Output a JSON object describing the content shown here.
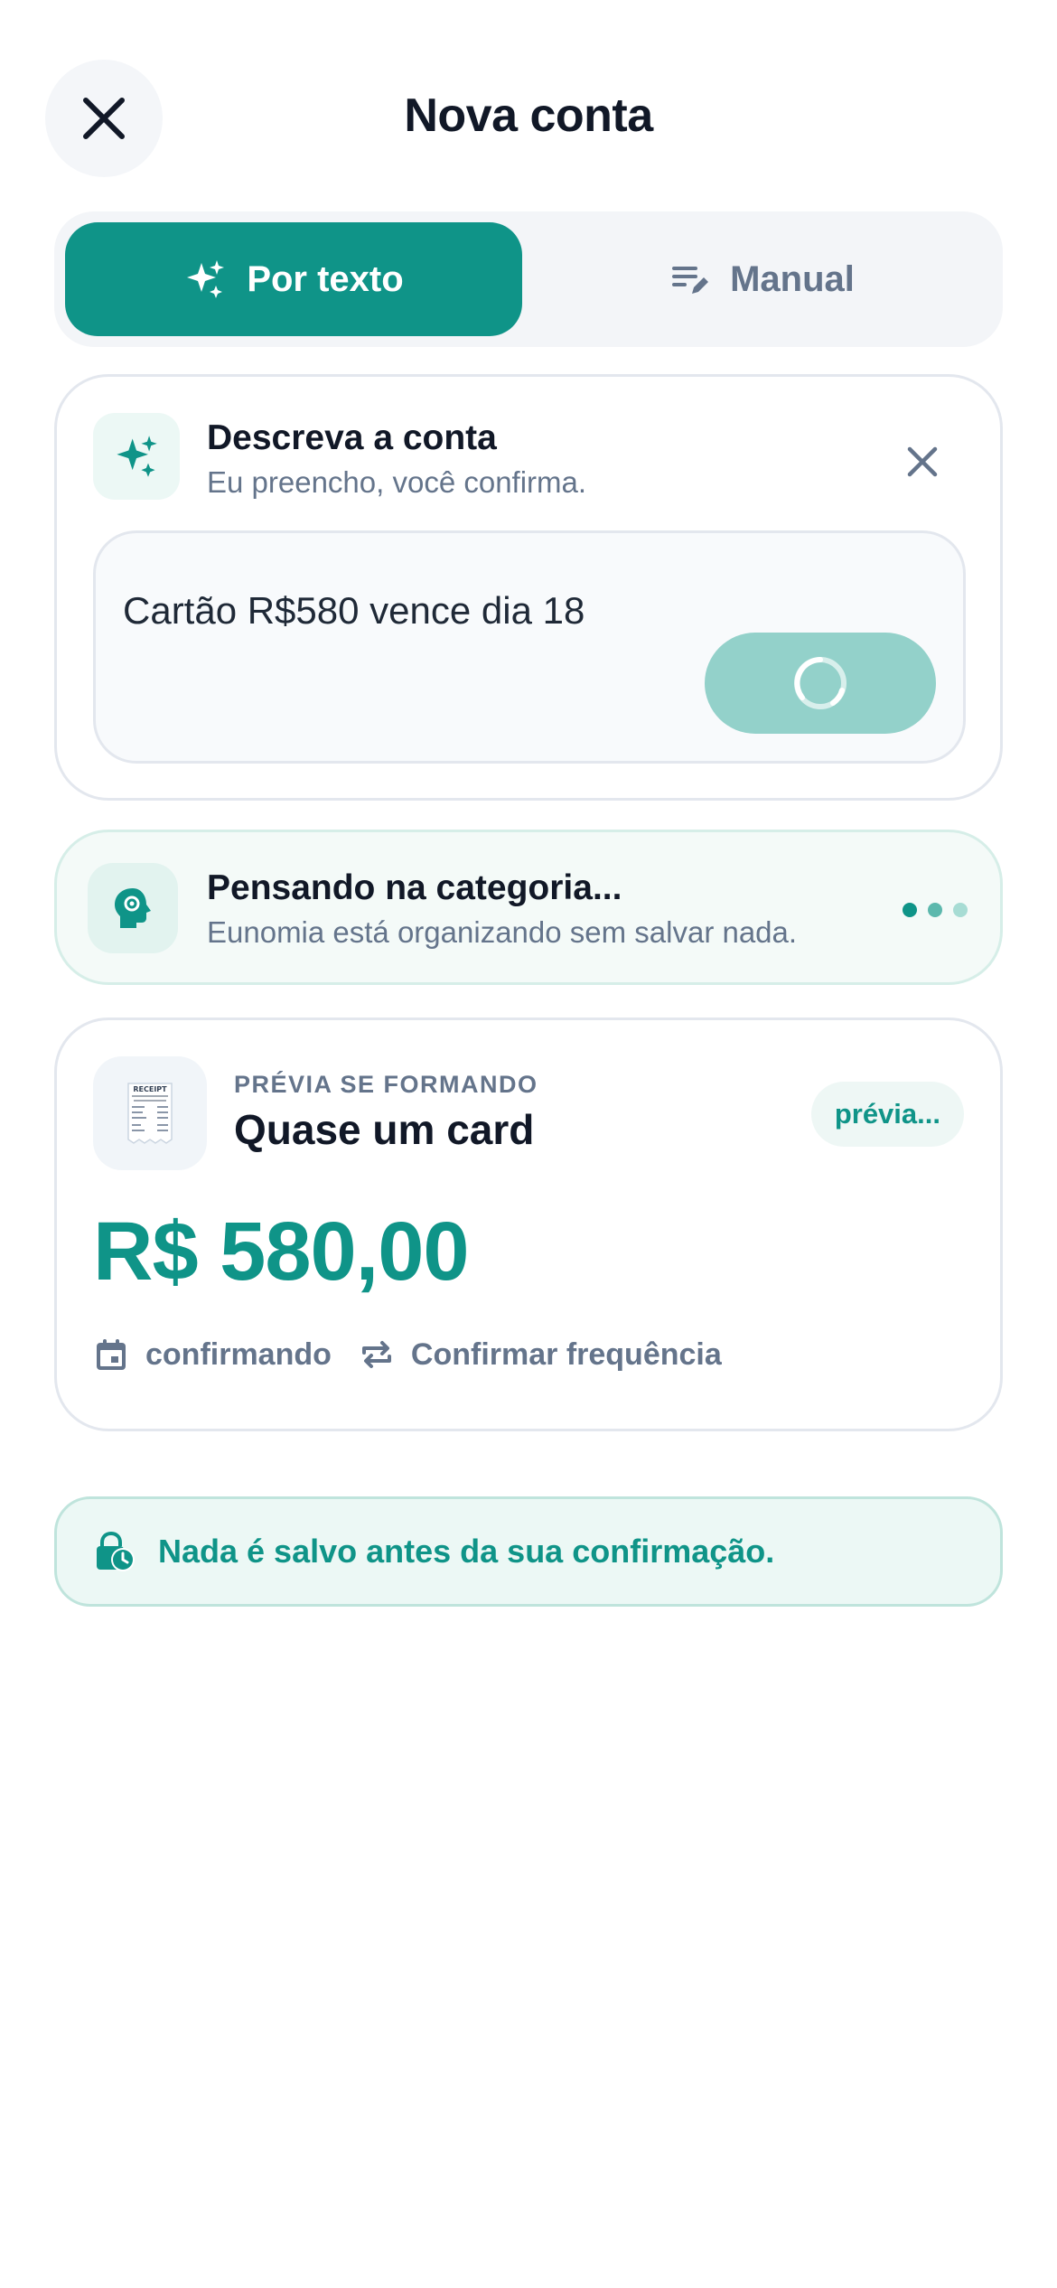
{
  "header": {
    "title": "Nova conta"
  },
  "tabs": [
    {
      "label": "Por texto",
      "active": true
    },
    {
      "label": "Manual",
      "active": false
    }
  ],
  "describe": {
    "title": "Descreva a conta",
    "subtitle": "Eu preencho, você confirma.",
    "input_value": "Cartão R$580 vence dia 18",
    "submit_state": "loading"
  },
  "thinking": {
    "title": "Pensando na categoria...",
    "subtitle": "Eunomia está organizando sem salvar nada."
  },
  "preview": {
    "eyebrow": "PRÉVIA SE FORMANDO",
    "title": "Quase um card",
    "badge": "prévia...",
    "amount": "R$ 580,00",
    "date_status": "confirmando",
    "frequency": "Confirmar frequência",
    "receipt_label": "RECEIPT"
  },
  "notice": {
    "text": "Nada é salvo antes da sua confirmação."
  },
  "colors": {
    "accent": "#0f9488",
    "accent_light": "#93d1ca",
    "muted_text": "#64748b",
    "surface": "#f3f5f8"
  },
  "icons": {
    "close": "close-icon",
    "sparkles": "sparkles-icon",
    "manual": "edit-list-icon",
    "dismiss": "close-icon",
    "spinner": "spinner-icon",
    "brain": "head-gear-icon",
    "receipt": "receipt-icon",
    "calendar": "calendar-icon",
    "repeat": "repeat-icon",
    "lock_clock": "lock-clock-icon"
  }
}
